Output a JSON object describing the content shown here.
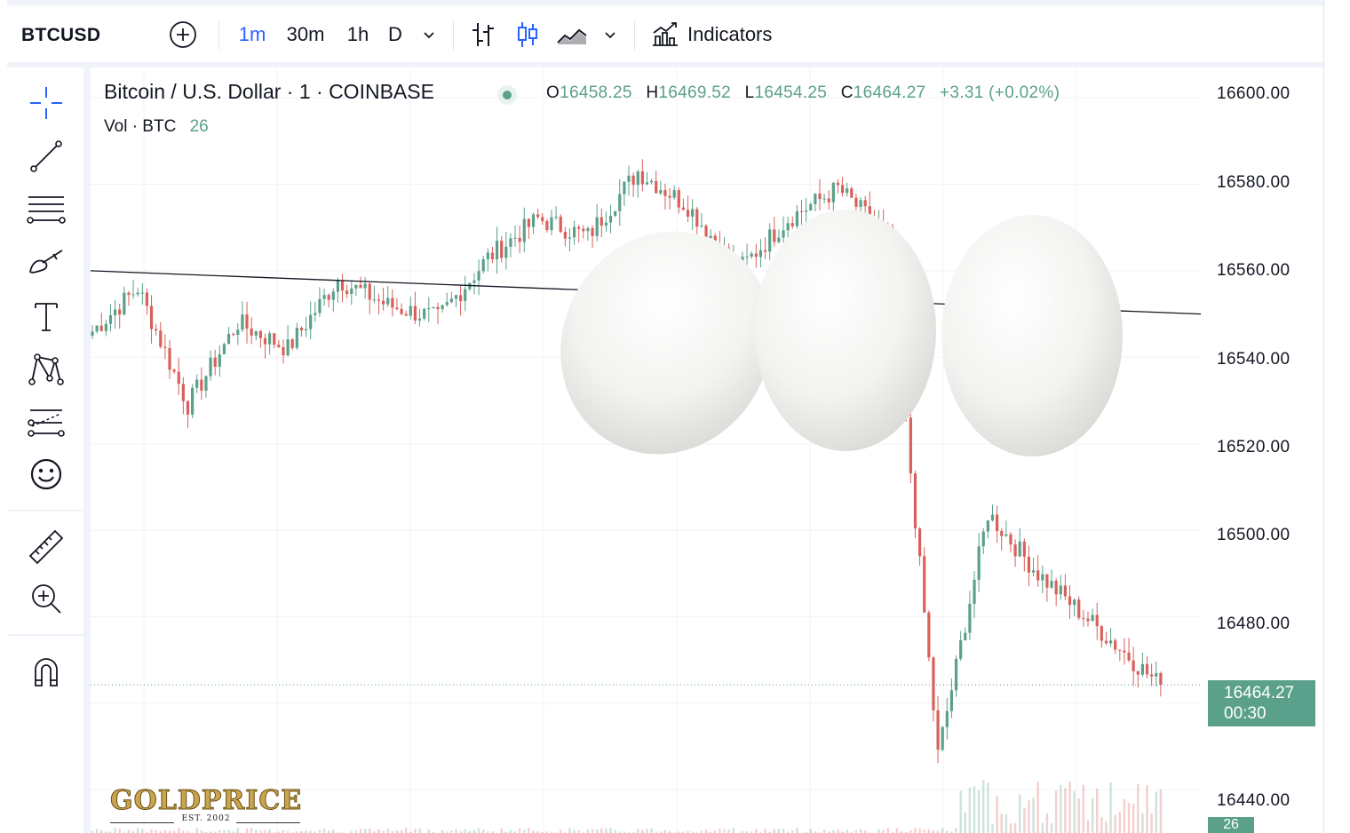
{
  "toolbar": {
    "symbol": "BTCUSD",
    "intervals": [
      "1m",
      "30m",
      "1h",
      "D"
    ],
    "active_interval": "1m",
    "indicators_label": "Indicators",
    "accent": "#2962ff"
  },
  "legend": {
    "title": "Bitcoin / U.S. Dollar · 1 · COINBASE",
    "o_key": "O",
    "o": "16458.25",
    "h_key": "H",
    "h": "16469.52",
    "l_key": "L",
    "l": "16454.25",
    "c_key": "C",
    "c": "16464.27",
    "change": "+3.31 (+0.02%)",
    "vol_label": "Vol · BTC",
    "vol_value": "26"
  },
  "price_scale": {
    "labels": [
      "16600.00",
      "16580.00",
      "16560.00",
      "16540.00",
      "16520.00",
      "16500.00",
      "16480.00",
      "16440.00"
    ],
    "last_price": "16464.27",
    "countdown": "00:30",
    "volume_label": "26"
  },
  "colors": {
    "up": "#5aa08a",
    "down": "#d9605b",
    "last_price_bg": "#5aa08a"
  },
  "logo": {
    "name": "GOLDPRICE",
    "est": "EST. 2002"
  },
  "chart_data": {
    "type": "candlestick",
    "symbol": "BTCUSD",
    "interval": "1m",
    "y_range": [
      16430,
      16607
    ],
    "grid": true,
    "segments": [
      {
        "from": 16545,
        "to": 16556
      },
      {
        "from": 16556,
        "to": 16529
      },
      {
        "from": 16529,
        "to": 16548
      },
      {
        "from": 16548,
        "to": 16542
      },
      {
        "from": 16542,
        "to": 16558
      },
      {
        "from": 16558,
        "to": 16552
      },
      {
        "from": 16552,
        "to": 16549
      },
      {
        "from": 16549,
        "to": 16563
      },
      {
        "from": 16563,
        "to": 16572
      },
      {
        "from": 16572,
        "to": 16568
      },
      {
        "from": 16568,
        "to": 16583
      },
      {
        "from": 16583,
        "to": 16575
      },
      {
        "from": 16575,
        "to": 16560
      },
      {
        "from": 16560,
        "to": 16572
      },
      {
        "from": 16572,
        "to": 16579
      },
      {
        "from": 16579,
        "to": 16568
      },
      {
        "from": 16568,
        "to": 16448
      },
      {
        "from": 16448,
        "to": 16504
      },
      {
        "from": 16504,
        "to": 16490
      },
      {
        "from": 16490,
        "to": 16464
      }
    ],
    "trendline": {
      "start": 16560,
      "end": 16550
    },
    "last_price": 16464.27
  }
}
